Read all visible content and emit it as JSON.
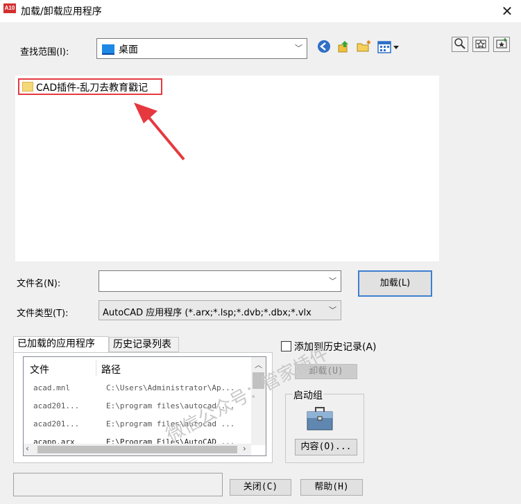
{
  "window": {
    "title": "加载/卸载应用程序",
    "app_icon_text": "A10"
  },
  "lookin": {
    "label": "查找范围(I):",
    "value": "桌面"
  },
  "toolbar": {
    "icons": [
      "back-icon",
      "up-folder-icon",
      "new-folder-icon",
      "views-menu-icon"
    ]
  },
  "right_tools": {
    "icons": [
      "find-icon",
      "favorites-icon",
      "add-favorite-icon"
    ]
  },
  "files": [
    {
      "name": "CAD插件-乱刀去教育戳记"
    }
  ],
  "filename": {
    "label": "文件名(N):",
    "value": ""
  },
  "filetype": {
    "label": "文件类型(T):",
    "value": "AutoCAD 应用程序 (*.arx;*.lsp;*.dvb;*.dbx;*.vlx"
  },
  "load_button": "加载(L)",
  "tabs": [
    {
      "label": "已加载的应用程序"
    },
    {
      "label": "历史记录列表"
    }
  ],
  "loaded_apps": {
    "col_file": "文件",
    "col_path": "路径",
    "rows": [
      {
        "file": "acad.mnl",
        "path": "C:\\Users\\Administrator\\Ap..."
      },
      {
        "file": "acad201...",
        "path": "E:\\program files\\autocad ..."
      },
      {
        "file": "acad201...",
        "path": "E:\\program files\\autocad ..."
      },
      {
        "file": "acapp.arx",
        "path": "E:\\Program Files\\AutoCAD ..."
      }
    ]
  },
  "add_history": {
    "label": "添加到历史记录(A)",
    "checked": false
  },
  "unload_button": "卸载(U)",
  "startup_suite": {
    "label": "启动组",
    "contents_button": "内容(O)..."
  },
  "close_button": "关闭(C)",
  "help_button": "帮助(H)",
  "watermark": "微信公众号：管家插件",
  "colors": {
    "highlight_border": "#e5393f",
    "arrow": "#e5393f"
  }
}
